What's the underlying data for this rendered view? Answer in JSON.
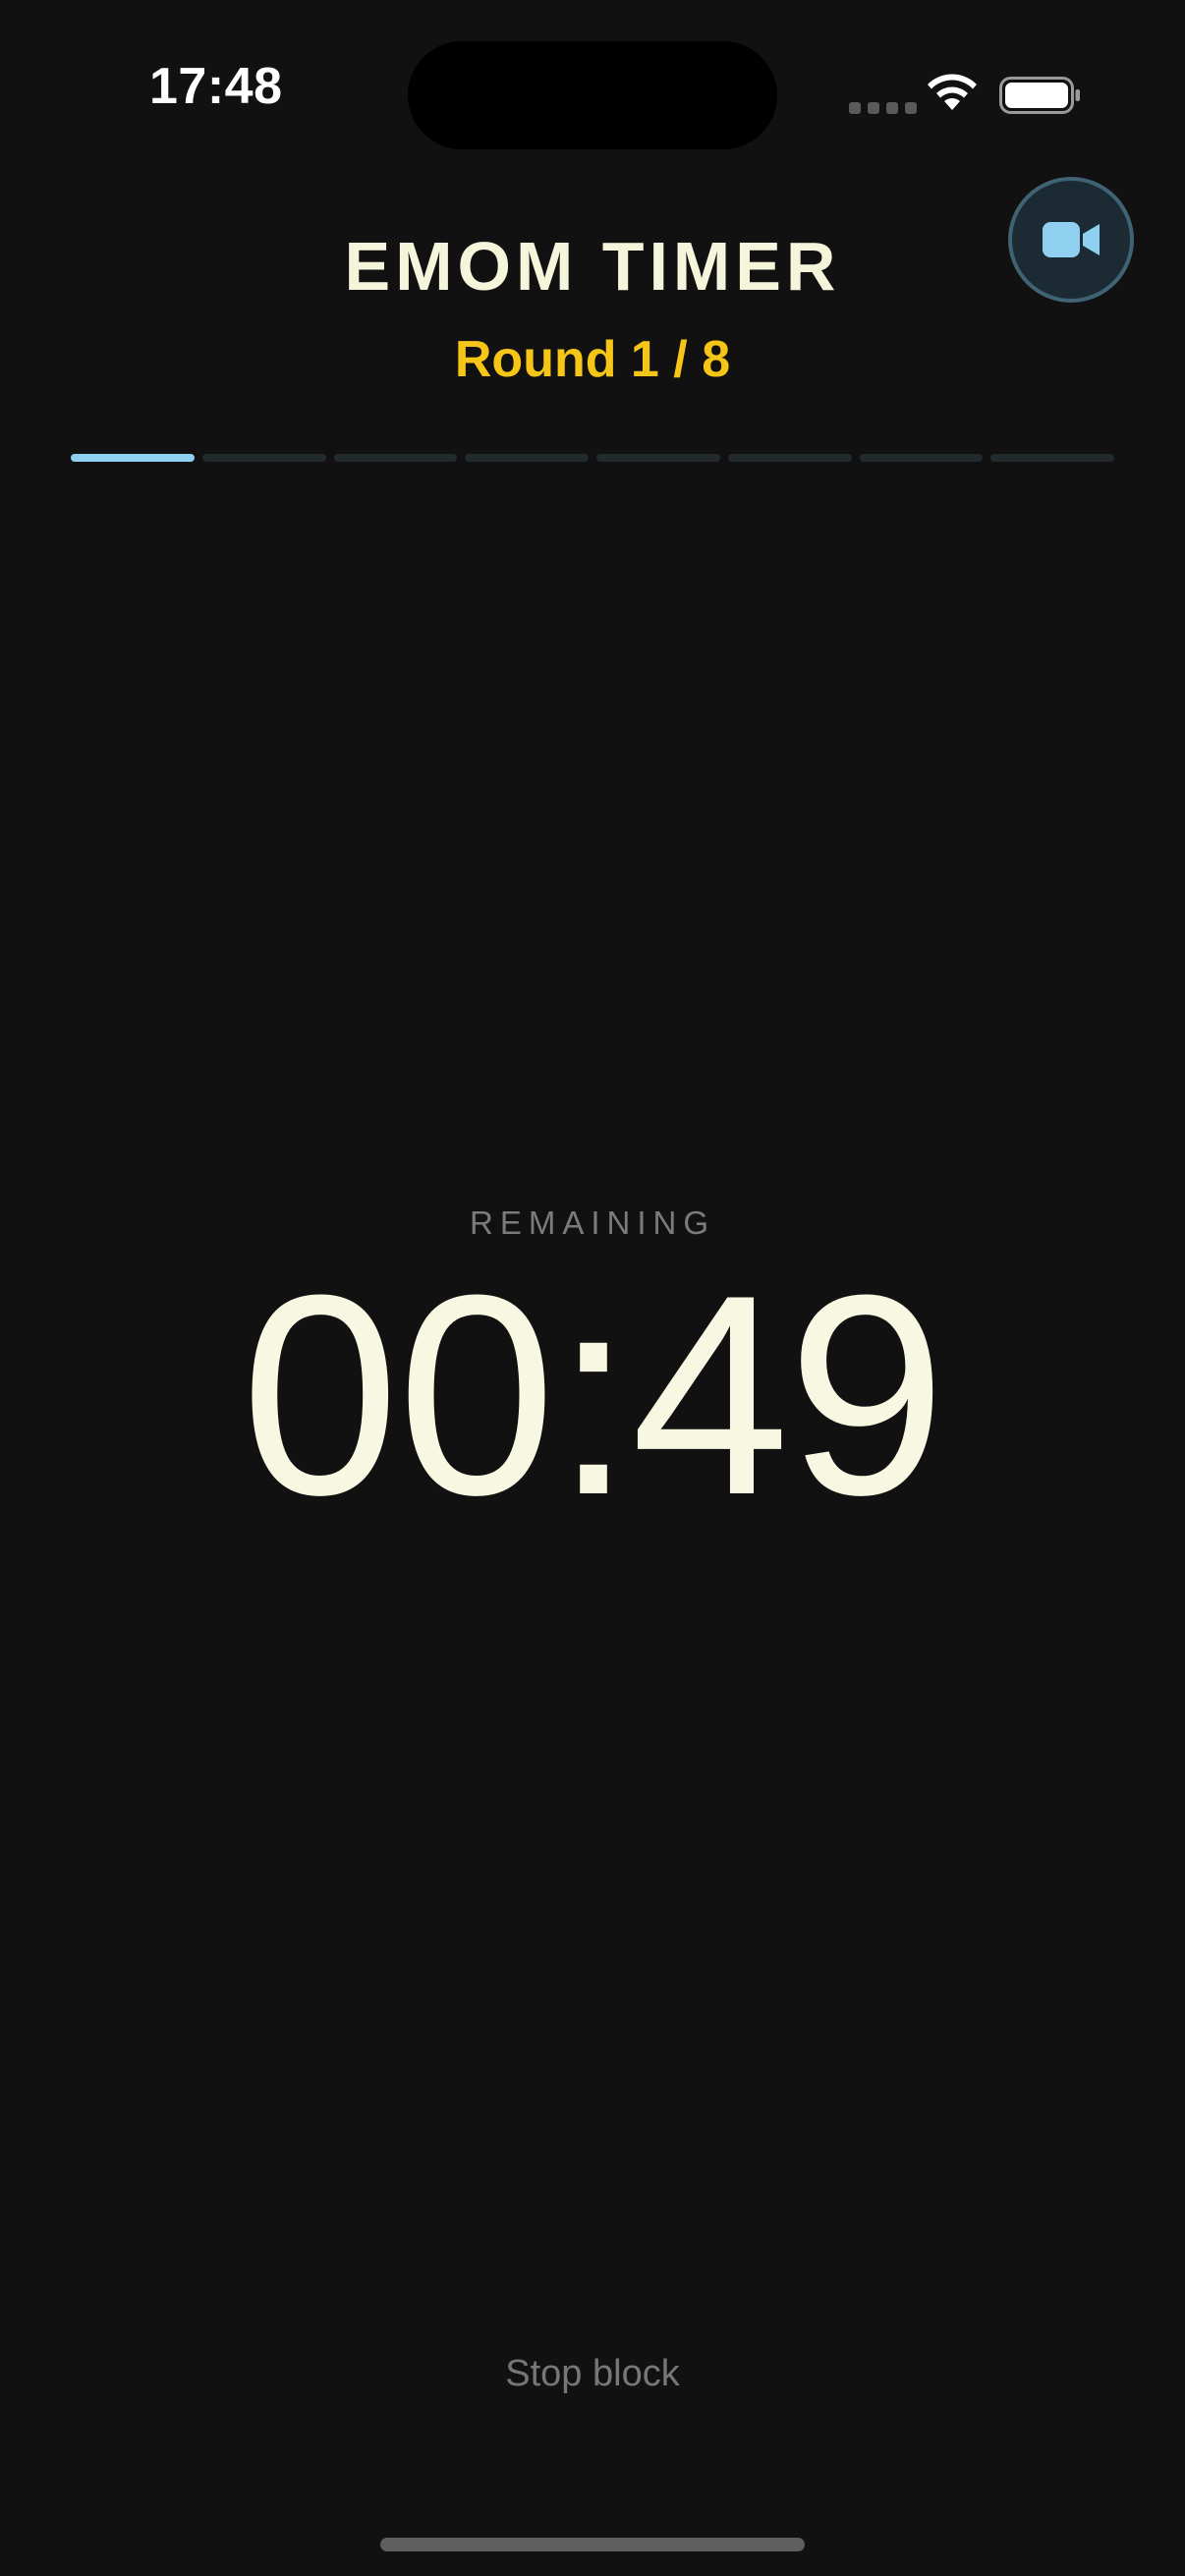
{
  "status_bar": {
    "time": "17:48",
    "wifi_icon": "wifi-icon",
    "battery_icon": "battery-icon"
  },
  "header": {
    "title": "EMOM TIMER",
    "round_label": "Round 1 / 8",
    "camera_icon": "video-camera-icon"
  },
  "progress": {
    "current_round": 1,
    "total_rounds": 8
  },
  "timer": {
    "label": "REMAINING",
    "value": "00:49"
  },
  "footer": {
    "stop_label": "Stop block"
  },
  "colors": {
    "background": "#111111",
    "title": "#f5f5dc",
    "round": "#f5c518",
    "active_segment": "#8fd0f0",
    "inactive_segment": "#222a2e",
    "camera_icon": "#8fd0f0"
  }
}
